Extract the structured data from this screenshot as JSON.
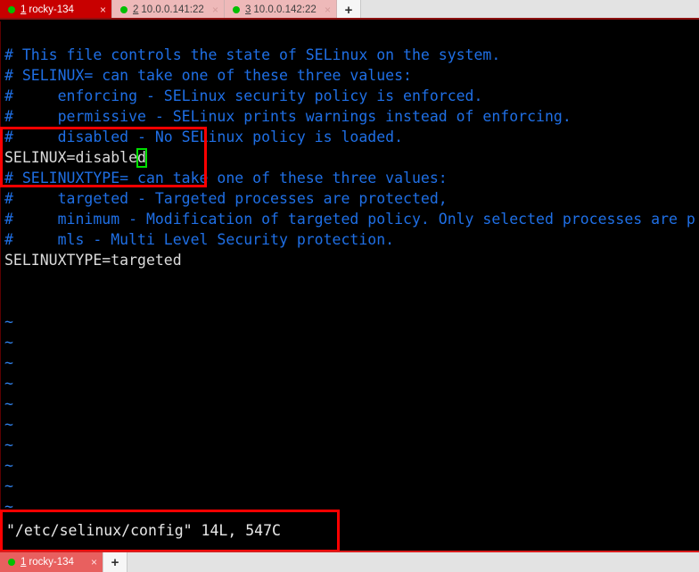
{
  "colors": {
    "active_tab_bg": "#c80000",
    "inactive_tab_bg": "#eeb9b9",
    "status_dot": "#00c000",
    "annotation": "#fe0000",
    "cursor": "#00e000",
    "comment_text": "#1f6fe5",
    "normal_text": "#dcdcdc",
    "terminal_bg": "#000000"
  },
  "tabbar": {
    "tabs": [
      {
        "index": "1",
        "label": "rocky-134",
        "status_icon": "green-dot",
        "close_icon": "×",
        "active": true
      },
      {
        "index": "2",
        "label": "10.0.0.141:22",
        "status_icon": "green-dot",
        "close_icon": "×",
        "active": false
      },
      {
        "index": "3",
        "label": "10.0.0.142:22",
        "status_icon": "green-dot",
        "close_icon": "×",
        "active": false
      }
    ],
    "new_tab_label": "+"
  },
  "terminal": {
    "lines": [
      {
        "text": "# This file controls the state of SELinux on the system.",
        "type": "comment"
      },
      {
        "text": "# SELINUX= can take one of these three values:",
        "type": "comment"
      },
      {
        "text": "#     enforcing - SELinux security policy is enforced.",
        "type": "comment"
      },
      {
        "text": "#     permissive - SELinux prints warnings instead of enforcing.",
        "type": "comment"
      },
      {
        "text": "#     disabled - No SELinux policy is loaded.",
        "type": "comment"
      },
      {
        "text": "SELINUX=disable",
        "type": "normal",
        "cursor_char": "d"
      },
      {
        "text": "# SELINUXTYPE= can take one of these three values:",
        "type": "comment"
      },
      {
        "text": "#     targeted - Targeted processes are protected,",
        "type": "comment"
      },
      {
        "text": "#     minimum - Modification of targeted policy. Only selected processes are p",
        "type": "comment"
      },
      {
        "text": "#     mls - Multi Level Security protection.",
        "type": "comment"
      },
      {
        "text": "SELINUXTYPE=targeted",
        "type": "normal"
      },
      {
        "text": "",
        "type": "blank"
      },
      {
        "text": "",
        "type": "blank"
      },
      {
        "text": "~",
        "type": "tilde"
      },
      {
        "text": "~",
        "type": "tilde"
      },
      {
        "text": "~",
        "type": "tilde"
      },
      {
        "text": "~",
        "type": "tilde"
      },
      {
        "text": "~",
        "type": "tilde"
      },
      {
        "text": "~",
        "type": "tilde"
      },
      {
        "text": "~",
        "type": "tilde"
      },
      {
        "text": "~",
        "type": "tilde"
      },
      {
        "text": "~",
        "type": "tilde"
      },
      {
        "text": "~",
        "type": "tilde"
      }
    ],
    "status_line": "\"/etc/selinux/config\" 14L, 547C"
  },
  "taskbar": {
    "items": [
      {
        "index": "1",
        "label": "rocky-134",
        "status_icon": "green-dot",
        "close_icon": "×"
      }
    ],
    "new_label": "+"
  }
}
